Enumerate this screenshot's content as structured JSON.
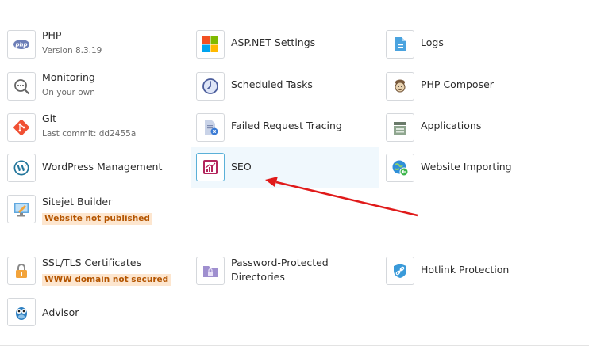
{
  "tools": {
    "php": {
      "title": "PHP",
      "subtitle": "Version 8.3.19",
      "icon": "php-icon"
    },
    "aspnet": {
      "title": "ASP.NET Settings",
      "icon": "windows-icon"
    },
    "logs": {
      "title": "Logs",
      "icon": "document-icon"
    },
    "monitoring": {
      "title": "Monitoring",
      "subtitle": "On your own",
      "icon": "monitoring-icon"
    },
    "scheduled": {
      "title": "Scheduled Tasks",
      "icon": "clock-icon"
    },
    "composer": {
      "title": "PHP Composer",
      "icon": "composer-icon"
    },
    "git": {
      "title": "Git",
      "subtitle": "Last commit: dd2455a",
      "icon": "git-icon"
    },
    "failed": {
      "title": "Failed Request Tracing",
      "icon": "error-document-icon"
    },
    "applications": {
      "title": "Applications",
      "icon": "applications-icon"
    },
    "wordpress": {
      "title": "WordPress Management",
      "icon": "wordpress-icon"
    },
    "seo": {
      "title": "SEO",
      "icon": "seo-chart-icon"
    },
    "importing": {
      "title": "Website Importing",
      "icon": "globe-import-icon"
    },
    "sitejet": {
      "title": "Sitejet Builder",
      "badge": "Website not published",
      "icon": "sitejet-icon"
    },
    "ssl": {
      "title": "SSL/TLS Certificates",
      "badge": "WWW domain not secured",
      "icon": "lock-icon"
    },
    "password": {
      "title": "Password-Protected",
      "title_line2": "Directories",
      "icon": "protected-folder-icon"
    },
    "hotlink": {
      "title": "Hotlink Protection",
      "icon": "shield-link-icon"
    },
    "advisor": {
      "title": "Advisor",
      "icon": "owl-icon"
    }
  },
  "colors": {
    "badge_text": "#b45500",
    "badge_bg": "#fde6cf",
    "highlight_bg": "#f0f8fd",
    "arrow": "#e01a1a"
  }
}
